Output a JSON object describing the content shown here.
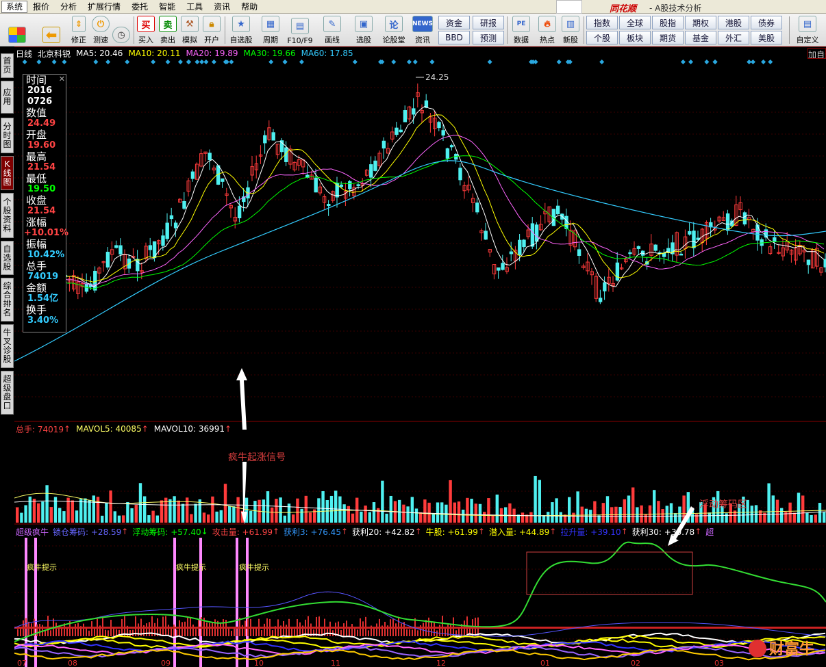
{
  "menu": [
    "系统",
    "报价",
    "分析",
    "扩展行情",
    "委托",
    "智能",
    "工具",
    "资讯",
    "帮助"
  ],
  "app": {
    "logo": "同花顺",
    "subtitle": "- A股技术分析"
  },
  "toolbar": {
    "buttons": [
      "修正",
      "测速",
      "买入",
      "卖出",
      "模拟",
      "开户",
      "自选股",
      "周期",
      "F10/F9",
      "画线",
      "选股",
      "论股堂",
      "资讯",
      "数据",
      "热点",
      "新股",
      "自定义"
    ],
    "small_buttons_left": [
      "资金",
      "研报",
      "BBD",
      "预测"
    ],
    "small_buttons_right": [
      "指数",
      "全球",
      "股指",
      "期权",
      "港股",
      "债券",
      "个股",
      "板块",
      "期货",
      "基金",
      "外汇",
      "美股"
    ],
    "icon_buy": "买",
    "icon_sell": "卖",
    "icon_news": "NEWS"
  },
  "sidebar": [
    "首页",
    "应用",
    "分时图",
    "K线图",
    "个股资料",
    "自选股",
    "综合排名",
    "牛叉诊股",
    "超级盘口"
  ],
  "chart_header": {
    "period": "日线",
    "stock": "北京科锐",
    "ma": [
      {
        "label": "MA5: 20.46",
        "color": "#ffffff"
      },
      {
        "label": "MA10: 20.11",
        "color": "#ffff00"
      },
      {
        "label": "MA20: 19.89",
        "color": "#ff66ff"
      },
      {
        "label": "MA30: 19.66",
        "color": "#00ff00"
      },
      {
        "label": "MA60: 17.85",
        "color": "#33ccff"
      }
    ],
    "right_tag": "加自选"
  },
  "info_box": [
    {
      "label": "时间",
      "value": "2016",
      "value2": "0726",
      "color": "#ffffff"
    },
    {
      "label": "数值",
      "value": "24.49",
      "color": "#ff4444"
    },
    {
      "label": "开盘",
      "value": "19.60",
      "color": "#ff4444"
    },
    {
      "label": "最高",
      "value": "21.54",
      "color": "#ff4444"
    },
    {
      "label": "最低",
      "value": "19.50",
      "color": "#00ff00"
    },
    {
      "label": "收盘",
      "value": "21.54",
      "color": "#ff4444"
    },
    {
      "label": "涨幅",
      "value": "+10.01%",
      "color": "#ff4444"
    },
    {
      "label": "振幅",
      "value": "10.42%",
      "color": "#33ccff"
    },
    {
      "label": "总手",
      "value": "74019",
      "color": "#33ccff"
    },
    {
      "label": "金额",
      "value": "1.54亿",
      "color": "#33ccff"
    },
    {
      "label": "换手",
      "value": "3.40%",
      "color": "#33ccff"
    }
  ],
  "price_high_label": "24.25",
  "volume_header": [
    {
      "label": "总手: 74019",
      "color": "#ff4444"
    },
    {
      "label": "MAVOL5: 40085",
      "color": "#ffff66"
    },
    {
      "label": "MAVOL10: 36991",
      "color": "#ffffff"
    }
  ],
  "indicator_header": [
    {
      "label": "超级疯牛",
      "color": "#cc66ff"
    },
    {
      "label": "锁仓筹码: +28.59",
      "color": "#6666ff"
    },
    {
      "label": "浮动筹码: +57.40",
      "color": "#00ff00"
    },
    {
      "label": "攻击量: +61.99",
      "color": "#ff4444"
    },
    {
      "label": "获利3: +76.45",
      "color": "#3399ff"
    },
    {
      "label": "获利20: +42.82",
      "color": "#ffffff"
    },
    {
      "label": "牛股: +61.99",
      "color": "#ffff00"
    },
    {
      "label": "潜入量: +44.89",
      "color": "#ffff00"
    },
    {
      "label": "拉升量: +39.10",
      "color": "#3333ff"
    },
    {
      "label": "获利30: +30.78",
      "color": "#ffffff"
    },
    {
      "label": "超",
      "color": "#cc66ff"
    }
  ],
  "signal_labels": [
    "疯牛提示",
    "疯牛提示",
    "疯牛提示"
  ],
  "annotations": {
    "bull_signal": "疯牛起涨信号",
    "float_zone": "浮动筹码区"
  },
  "x_axis": [
    "07",
    "08",
    "09",
    "10",
    "11",
    "12",
    "01",
    "02",
    "03"
  ],
  "watermark": "财富牛"
}
